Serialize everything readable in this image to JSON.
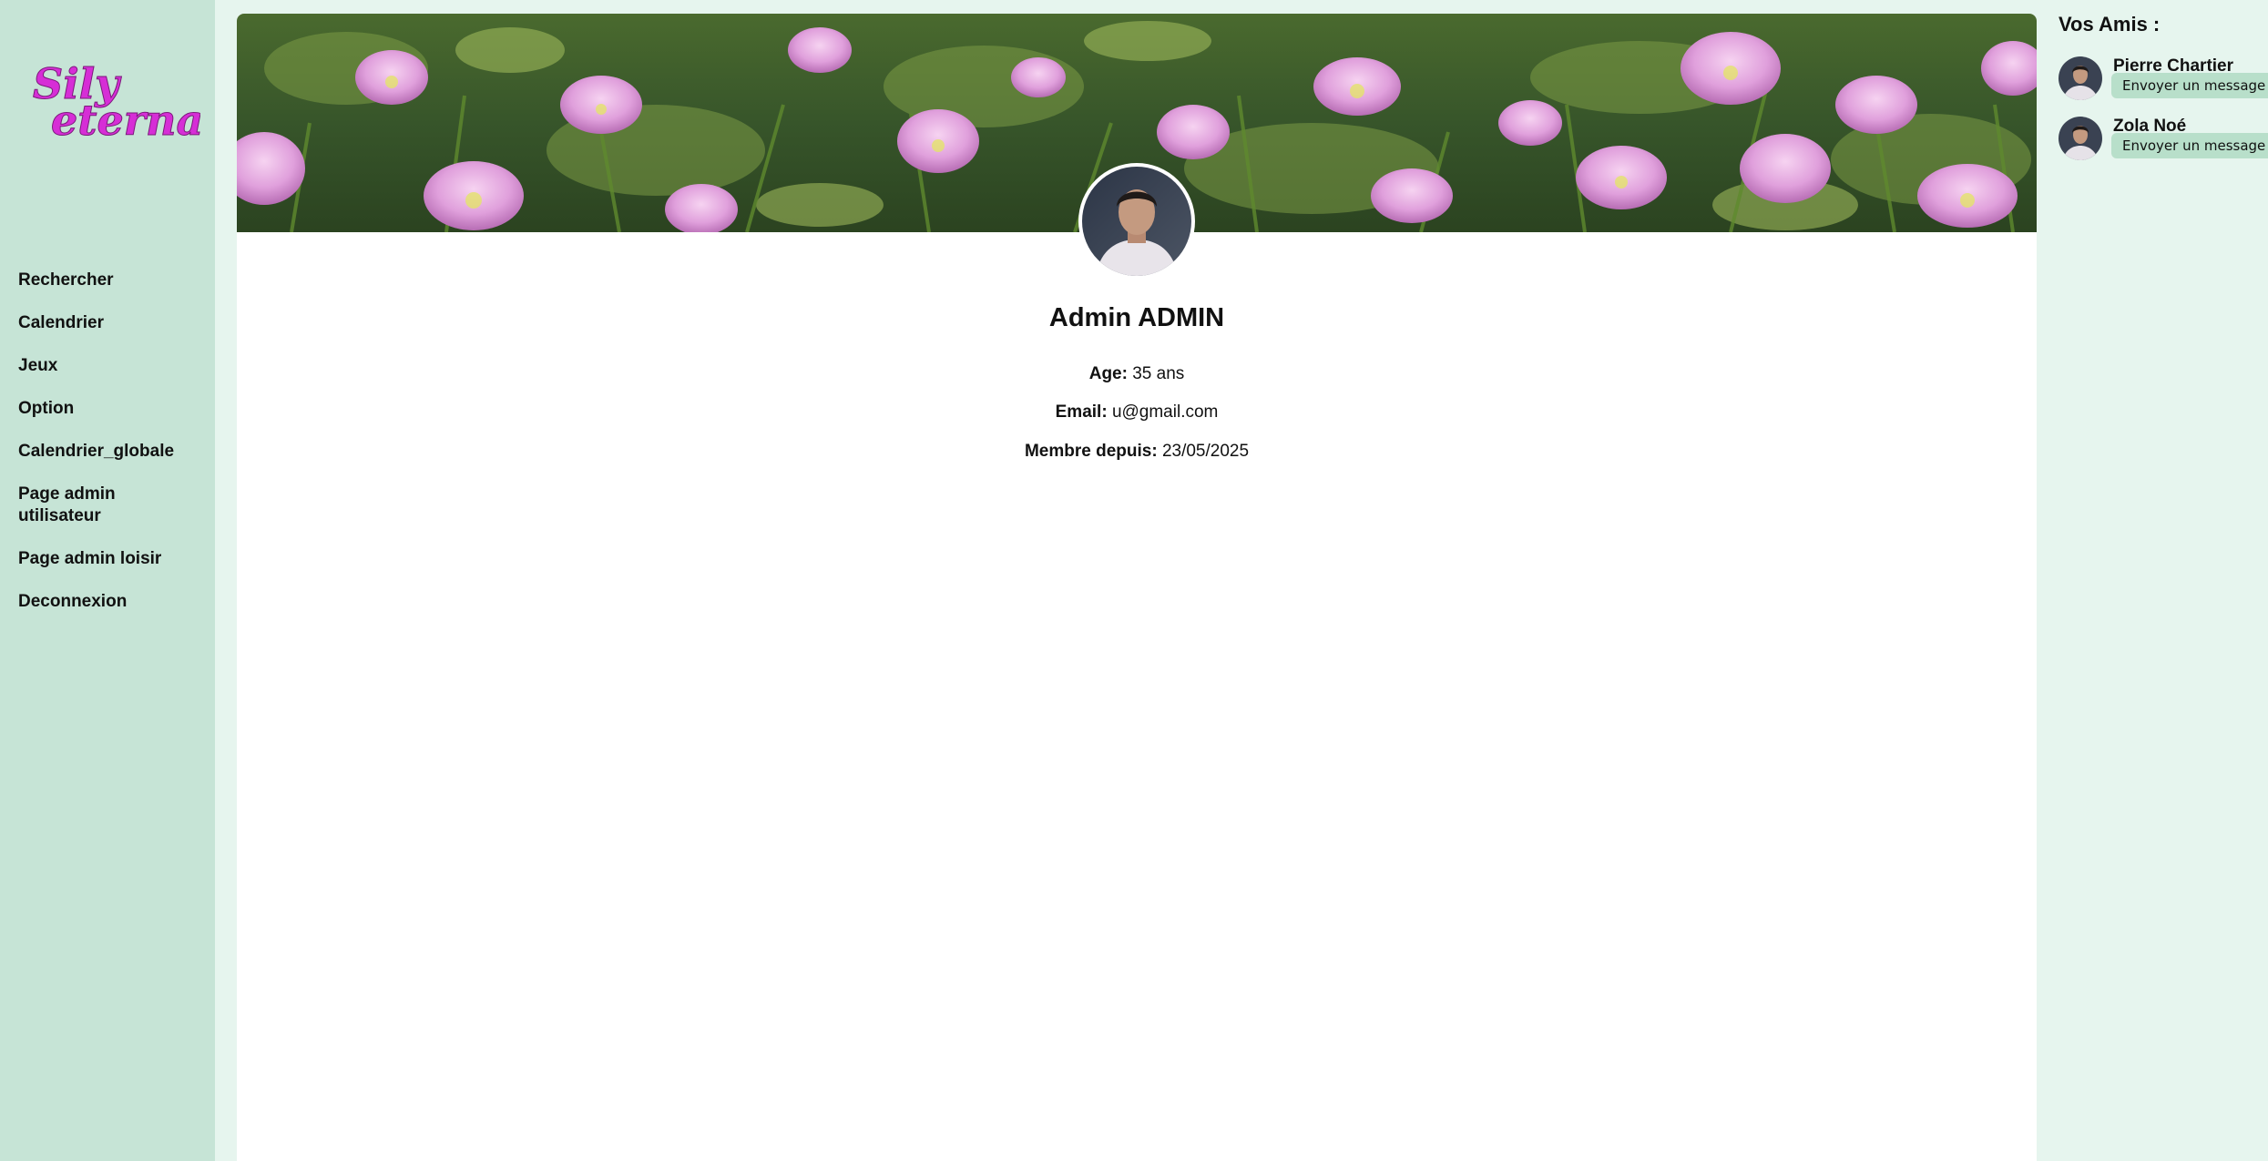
{
  "logo": {
    "line1": "Sily",
    "line2": "eterna",
    "color": "#d62ed6"
  },
  "sidebar": {
    "items": [
      {
        "label": "Rechercher"
      },
      {
        "label": "Calendrier"
      },
      {
        "label": "Jeux"
      },
      {
        "label": "Option"
      },
      {
        "label": "Calendrier_globale"
      },
      {
        "label": "Page admin utilisateur"
      },
      {
        "label": "Page admin loisir"
      },
      {
        "label": "Deconnexion"
      }
    ]
  },
  "profile": {
    "name": "Admin ADMIN",
    "age_label": "Age:",
    "age_value": "35 ans",
    "email_label": "Email:",
    "email_value": "u@gmail.com",
    "member_label": "Membre depuis:",
    "member_value": "23/05/2025"
  },
  "friends": {
    "title": "Vos Amis :",
    "list": [
      {
        "name": "Pierre Chartier",
        "button": "Envoyer un message"
      },
      {
        "name": "Zola Noé",
        "button": "Envoyer un message"
      }
    ]
  },
  "colors": {
    "sidebar_bg": "#c6e4d6",
    "page_bg": "#e6f5ee",
    "button_bg": "#b8dfca",
    "flower_pink": "#e7a6e3"
  }
}
